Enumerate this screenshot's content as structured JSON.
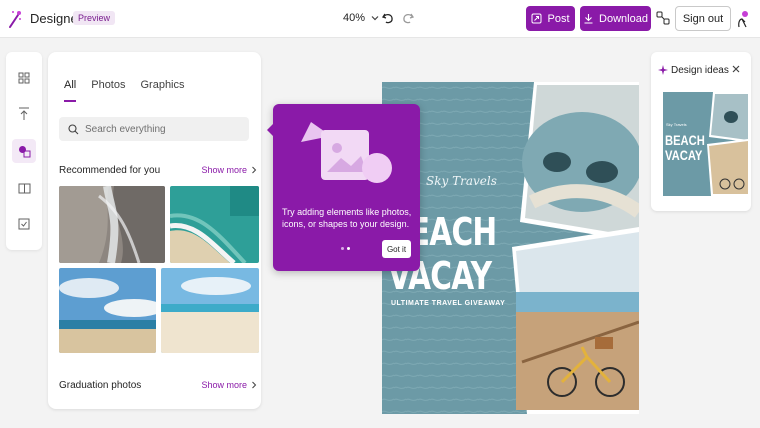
{
  "app": {
    "name": "Designer",
    "badge": "Preview"
  },
  "toolbar": {
    "zoom": "40%",
    "post_label": "Post",
    "download_label": "Download",
    "signout_label": "Sign out"
  },
  "panel": {
    "tabs": [
      {
        "label": "All"
      },
      {
        "label": "Photos"
      },
      {
        "label": "Graphics"
      }
    ],
    "search_placeholder": "Search everything",
    "section1_title": "Recommended for you",
    "section2_title": "Graduation photos",
    "show_more": "Show more"
  },
  "tooltip": {
    "text": "Try adding elements like photos, icons, or shapes to your design.",
    "button": "Got it"
  },
  "poster": {
    "brand": "Sky Travels",
    "title_line1": "BEACH",
    "title_line2": "VACAY",
    "subtitle": "ULTIMATE TRAVEL GIVEAWAY"
  },
  "ideas": {
    "title": "Design ideas",
    "thumb_brand": "Sky Travels",
    "thumb_title1": "BEACH",
    "thumb_title2": "VACAY"
  },
  "colors": {
    "accent": "#8a1aa8",
    "poster_bg": "#6c9aa6"
  }
}
